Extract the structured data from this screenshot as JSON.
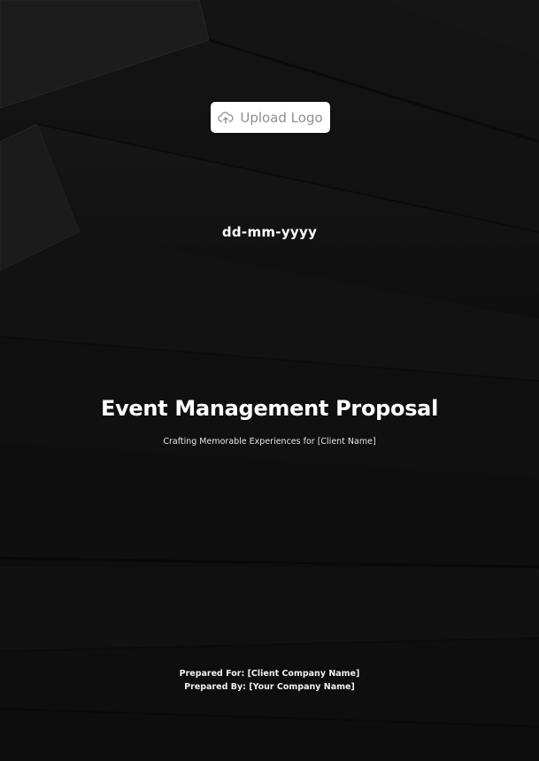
{
  "upload": {
    "label": "Upload Logo",
    "icon": "cloud-upload-icon"
  },
  "cover": {
    "date": "dd-mm-yyyy",
    "title": "Event Management Proposal",
    "subtitle": "Crafting Memorable Experiences for [Client Name]",
    "prepared_for": "Prepared For: [Client Company Name]",
    "prepared_by": "Prepared By: [Your Company Name]"
  },
  "colors": {
    "background": "#111111",
    "text": "#ffffff",
    "button_bg": "#ffffff",
    "button_text": "#8e8e8e"
  }
}
